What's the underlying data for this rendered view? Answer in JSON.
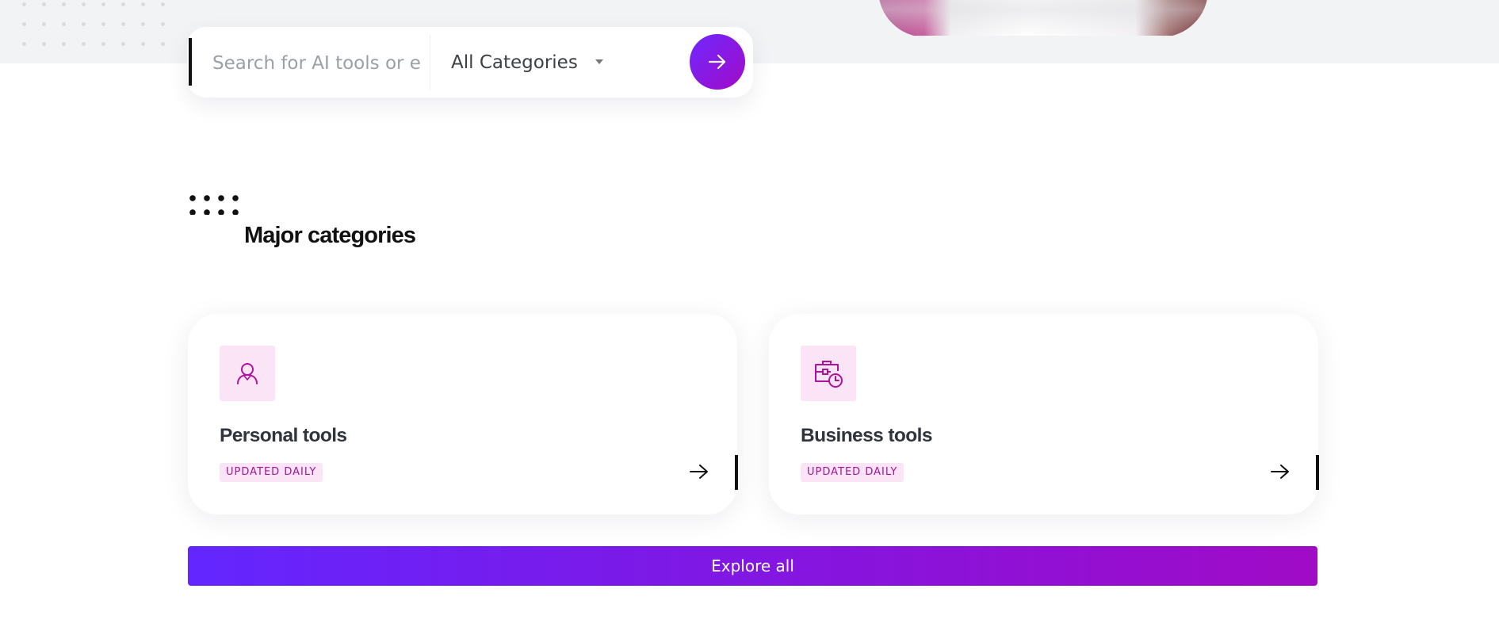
{
  "search": {
    "placeholder": "Search for AI tools or e",
    "category_selected": "All Categories",
    "submit_icon": "arrow-right-icon"
  },
  "section": {
    "title": "Major categories"
  },
  "cards": [
    {
      "icon": "person-icon",
      "title": "Personal tools",
      "badge": "UPDATED DAILY",
      "arrow_icon": "arrow-right-icon"
    },
    {
      "icon": "business-calendar-icon",
      "title": "Business tools",
      "badge": "UPDATED DAILY",
      "arrow_icon": "arrow-right-icon"
    }
  ],
  "explore": {
    "label": "Explore all"
  },
  "colors": {
    "accent_start": "#6326ff",
    "accent_end": "#a00bc6",
    "badge_bg": "#fbe4f6",
    "badge_text": "#a5149b",
    "icon_stroke": "#b0139b"
  }
}
